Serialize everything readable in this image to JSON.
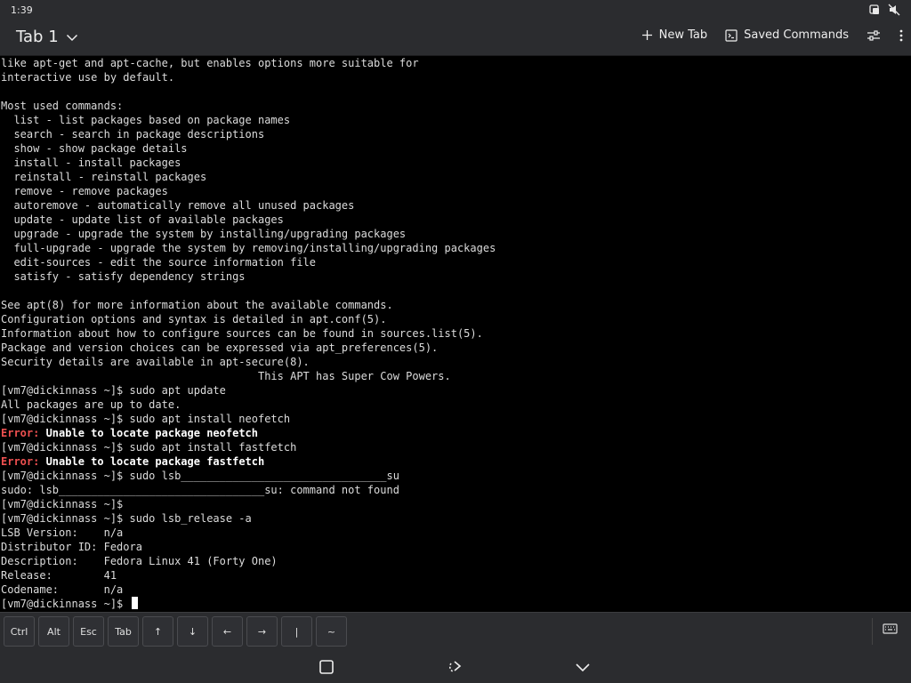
{
  "status_bar": {
    "time": "1:39",
    "icons": [
      "notification-icon",
      "mute-icon"
    ]
  },
  "header": {
    "tab_label": "Tab 1",
    "new_tab_label": "New Tab",
    "saved_commands_label": "Saved Commands"
  },
  "terminal": {
    "lines": [
      "like apt-get and apt-cache, but enables options more suitable for",
      "interactive use by default.",
      "",
      "Most used commands:",
      "  list - list packages based on package names",
      "  search - search in package descriptions",
      "  show - show package details",
      "  install - install packages",
      "  reinstall - reinstall packages",
      "  remove - remove packages",
      "  autoremove - automatically remove all unused packages",
      "  update - update list of available packages",
      "  upgrade - upgrade the system by installing/upgrading packages",
      "  full-upgrade - upgrade the system by removing/installing/upgrading packages",
      "  edit-sources - edit the source information file",
      "  satisfy - satisfy dependency strings",
      "",
      "See apt(8) for more information about the available commands.",
      "Configuration options and syntax is detailed in apt.conf(5).",
      "Information about how to configure sources can be found in sources.list(5).",
      "Package and version choices can be expressed via apt_preferences(5).",
      "Security details are available in apt-secure(8).",
      "                                        This APT has Super Cow Powers.",
      "[vm7@dickinnass ~]$ sudo apt update",
      "All packages are up to date.",
      "[vm7@dickinnass ~]$ sudo apt install neofetch"
    ],
    "error1_label": "Error:",
    "error1_msg": " Unable to locate package neofetch",
    "line_after_error1": "[vm7@dickinnass ~]$ sudo apt install fastfetch",
    "error2_label": "Error:",
    "error2_msg": " Unable to locate package fastfetch",
    "lines_tail": [
      "[vm7@dickinnass ~]$ sudo lsb________________________________su",
      "sudo: lsb________________________________su: command not found",
      "[vm7@dickinnass ~]$",
      "[vm7@dickinnass ~]$ sudo lsb_release -a",
      "LSB Version:    n/a",
      "Distributor ID: Fedora",
      "Description:    Fedora Linux 41 (Forty One)",
      "Release:        41",
      "Codename:       n/a"
    ],
    "prompt": "[vm7@dickinnass ~]$ "
  },
  "keybar": {
    "keys": [
      "Ctrl",
      "Alt",
      "Esc",
      "Tab",
      "↑",
      "↓",
      "←",
      "→",
      "|",
      "~"
    ]
  },
  "colors": {
    "background": "#2b2c2f",
    "terminal_bg": "#000000",
    "terminal_fg": "#dcdcdc",
    "error": "#ee5050"
  }
}
